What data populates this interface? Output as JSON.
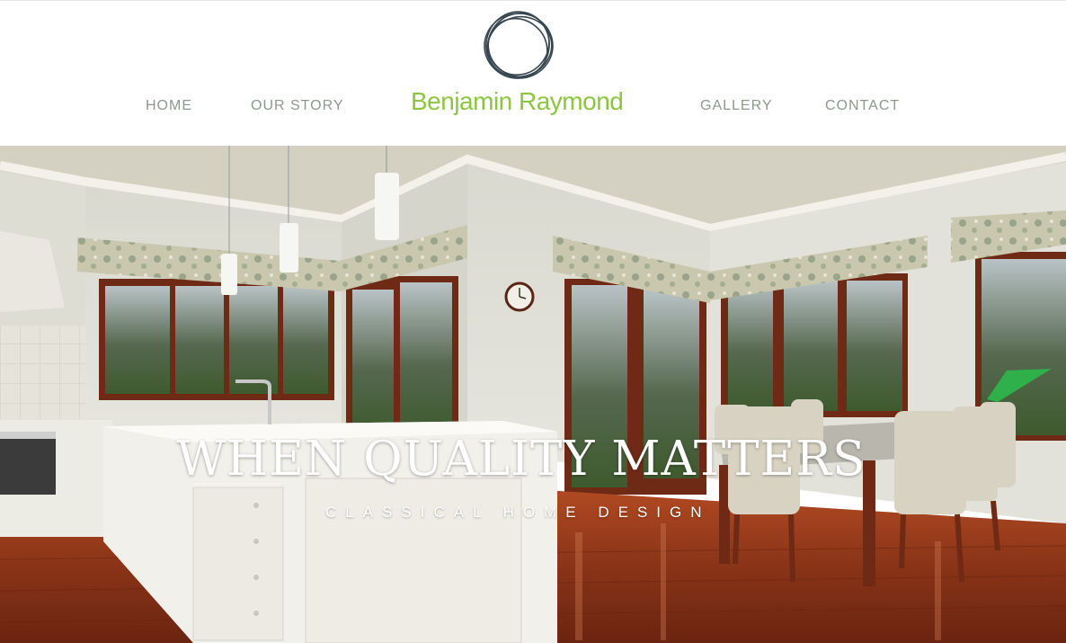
{
  "nav": {
    "home": "HOME",
    "our_story": "OUR STORY",
    "gallery": "GALLERY",
    "contact": "CONTACT"
  },
  "brand": {
    "name": "Benjamin Raymond",
    "logo": "scribble-circle-logo",
    "color": "#8cc63f"
  },
  "hero": {
    "title": "WHEN QUALITY MATTERS",
    "subtitle": "CLASSICAL HOME DESIGN",
    "image": "kitchen-dining-room-photo"
  },
  "colors": {
    "nav_text": "#8c9a8c",
    "floor": "#8a3418",
    "window_frame": "#6e2a14"
  }
}
